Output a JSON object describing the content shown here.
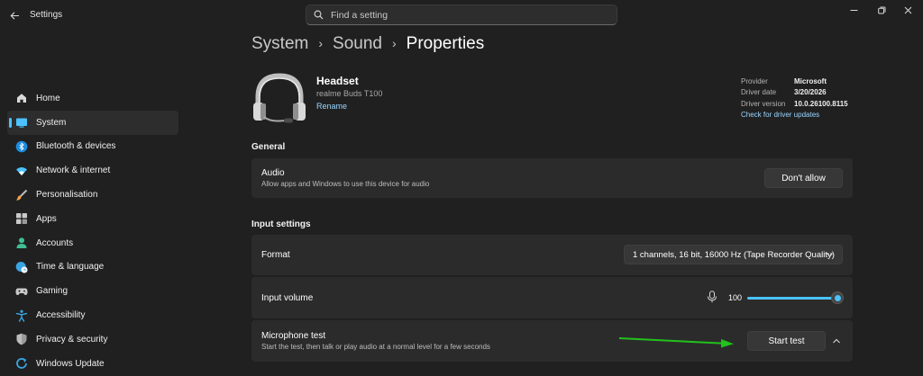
{
  "window": {
    "title": "Settings",
    "search_placeholder": "Find a setting"
  },
  "sidebar": {
    "items": [
      {
        "label": "Home",
        "icon": "home-icon"
      },
      {
        "label": "System",
        "icon": "system-display-icon",
        "active": true
      },
      {
        "label": "Bluetooth & devices",
        "icon": "bluetooth-icon"
      },
      {
        "label": "Network & internet",
        "icon": "wifi-icon"
      },
      {
        "label": "Personalisation",
        "icon": "paintbrush-icon"
      },
      {
        "label": "Apps",
        "icon": "apps-icon"
      },
      {
        "label": "Accounts",
        "icon": "person-icon"
      },
      {
        "label": "Time & language",
        "icon": "globe-clock-icon"
      },
      {
        "label": "Gaming",
        "icon": "gamepad-icon"
      },
      {
        "label": "Accessibility",
        "icon": "accessibility-icon"
      },
      {
        "label": "Privacy & security",
        "icon": "shield-icon"
      },
      {
        "label": "Windows Update",
        "icon": "update-icon"
      }
    ]
  },
  "breadcrumb": [
    "System",
    "Sound",
    "Properties"
  ],
  "device": {
    "name": "Headset",
    "model": "realme Buds T100",
    "rename": "Rename"
  },
  "driver": {
    "provider_label": "Provider",
    "provider": "Microsoft",
    "date_label": "Driver date",
    "date": "3/20/2026",
    "version_label": "Driver version",
    "version": "10.0.26100.8115",
    "check_link": "Check for driver updates"
  },
  "general": {
    "heading": "General",
    "audio_title": "Audio",
    "audio_desc": "Allow apps and Windows to use this device for audio",
    "audio_button": "Don't allow"
  },
  "input": {
    "heading": "Input settings",
    "format_label": "Format",
    "format_value": "1 channels, 16 bit, 16000 Hz (Tape Recorder Quality)",
    "volume_label": "Input volume",
    "volume_value": "100",
    "volume_level": 1.0,
    "mic_test_title": "Microphone test",
    "mic_test_desc": "Start the test, then talk or play audio at a normal level for a few seconds",
    "start_button": "Start test"
  },
  "colors": {
    "accent": "#4cc2ff",
    "annotation_arrow": "#21c21b"
  }
}
